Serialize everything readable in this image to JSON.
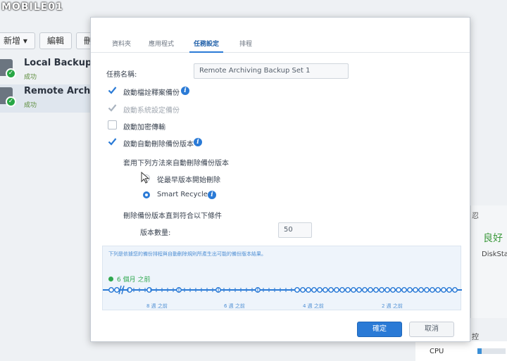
{
  "watermark": "MOBILE01",
  "background": {
    "toolbar": {
      "create": "新增 ▾",
      "edit": "編輯",
      "delete": "刪除"
    },
    "tasks": [
      {
        "title": "Local Backup S",
        "status": "成功"
      },
      {
        "title": "Remote Archivi",
        "status": "成功"
      }
    ],
    "right_panel": {
      "letter": "忍",
      "health": "良好",
      "disk": "DiskSta",
      "corner": "控"
    },
    "resource": {
      "cpu_label": "CPU",
      "cpu_fraction": 0.15
    }
  },
  "dialog": {
    "tabs": [
      "資料夾",
      "應用程式",
      "任務設定",
      "排程"
    ],
    "active_tab": "任務設定",
    "task_name_label": "任務名稱:",
    "task_name_value": "Remote Archiving Backup Set 1",
    "options": {
      "metadata_backup": "啟動檔詮釋案備份",
      "system_config_backup": "啟動系統設定備份",
      "encryption": "啟動加密傳輸",
      "auto_delete": "啟動自動刪除備份版本"
    },
    "rotation_intro": "套用下列方法來自動刪除備份版本",
    "rotation_methods": {
      "earliest": "從最早版本開始刪除",
      "smart": "Smart Recycle"
    },
    "condition_intro": "刪除備份版本直到符合以下條件",
    "version_count_label": "版本數量:",
    "version_count_value": "50",
    "timeline": {
      "description": "下列是依據您的備份排程與自動刪除規則所產生出可能的備份版本結果。",
      "now_label": "6 個月 之前",
      "ticks": [
        "8 週 之前",
        "6 週 之前",
        "4 週 之前",
        "2 週 之前"
      ]
    },
    "buttons": {
      "ok": "確定",
      "cancel": "取消"
    }
  },
  "colors": {
    "accent": "#2a7ad6",
    "success": "#2fa84f"
  }
}
